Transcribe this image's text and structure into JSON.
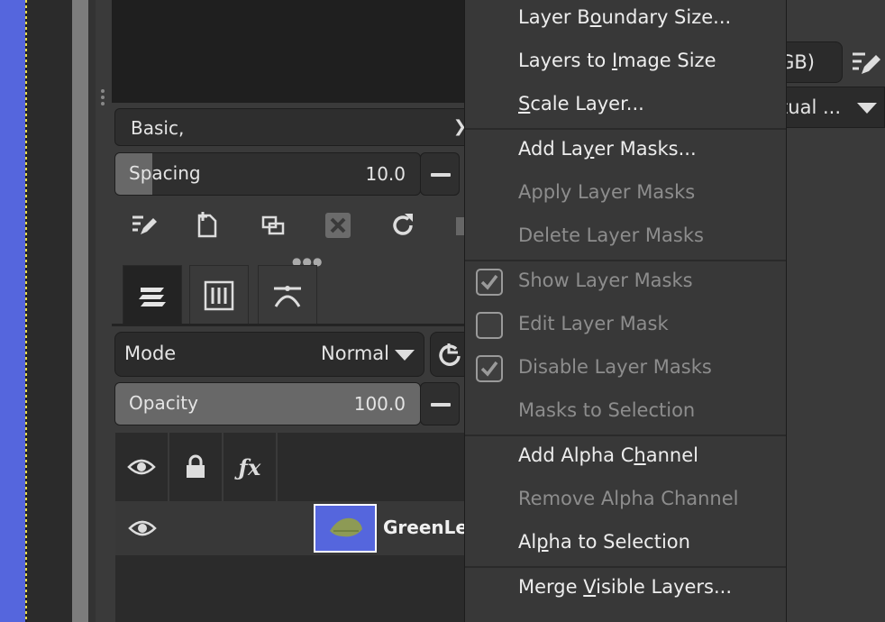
{
  "left_dock": {
    "brush_preset": "Basic,",
    "spacing": {
      "label": "Spacing",
      "value": "10.0",
      "fill_fraction": 0.12
    },
    "opacity": {
      "label": "Opacity",
      "value": "100.0",
      "fill_fraction": 1.0
    },
    "mode": {
      "label": "Mode",
      "value": "Normal"
    },
    "tabs": [
      {
        "icon": "layers-icon",
        "active": true
      },
      {
        "icon": "channels-icon",
        "active": false
      },
      {
        "icon": "paths-icon",
        "active": false
      }
    ],
    "layer_header": {
      "fx": "ƒx"
    },
    "layer": {
      "name": "GreenLea"
    }
  },
  "right_toolbar": {
    "color_space": "GB)",
    "rendering_intent": "tual ..."
  },
  "menu": {
    "items": [
      {
        "label": "Layer Boundary Size...",
        "pre": "Layer B",
        "u": "o",
        "post": "undary Size...",
        "disabled": false
      },
      {
        "label": "Layers to Image Size",
        "pre": "Layers to ",
        "u": "I",
        "post": "mage Size",
        "disabled": false
      },
      {
        "label": "Scale Layer...",
        "pre": "",
        "u": "S",
        "post": "cale Layer...",
        "disabled": false
      },
      {
        "label": "Add Layer Masks...",
        "pre": "Add La",
        "u": "y",
        "post": "er Masks...",
        "disabled": false
      },
      {
        "label": "Apply Layer Masks",
        "pre": "Apply Layer Masks",
        "u": "",
        "post": "",
        "disabled": true
      },
      {
        "label": "Delete Layer Masks",
        "pre": "Delete Layer Masks",
        "u": "",
        "post": "",
        "disabled": true
      },
      {
        "label": "Show Layer Masks",
        "pre": "Show Layer Masks",
        "u": "",
        "post": "",
        "disabled": true,
        "checkbox": true,
        "checked": true
      },
      {
        "label": "Edit Layer Mask",
        "pre": "Edit Layer Mask",
        "u": "",
        "post": "",
        "disabled": true,
        "checkbox": true,
        "checked": false
      },
      {
        "label": "Disable Layer Masks",
        "pre": "Disable Layer Masks",
        "u": "",
        "post": "",
        "disabled": true,
        "checkbox": true,
        "checked": true
      },
      {
        "label": "Masks to Selection",
        "pre": "Masks to Selection",
        "u": "",
        "post": "",
        "disabled": true
      },
      {
        "label": "Add Alpha Channel",
        "pre": "Add Alpha C",
        "u": "h",
        "post": "annel",
        "disabled": false
      },
      {
        "label": "Remove Alpha Channel",
        "pre": "Remove Alpha Channel",
        "u": "",
        "post": "",
        "disabled": true
      },
      {
        "label": "Alpha to Selection",
        "pre": "Al",
        "u": "p",
        "post": "ha to Selection",
        "disabled": false
      },
      {
        "label": "Merge Visible Layers...",
        "pre": "Merge ",
        "u": "V",
        "post": "isible Layers...",
        "disabled": false
      }
    ]
  },
  "colors": {
    "canvas_blue": "#5566dd",
    "menu_bg": "#383838",
    "disabled_text": "#8d8d8d",
    "panel_bg": "#3a3a3a"
  }
}
